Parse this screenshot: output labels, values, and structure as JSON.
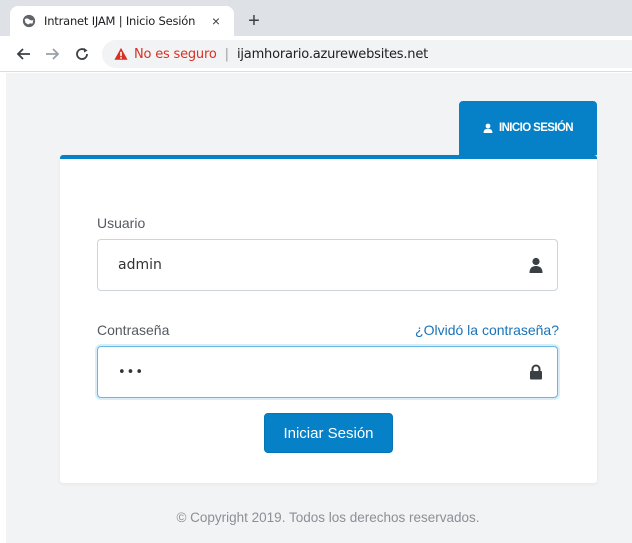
{
  "browser": {
    "tab_title": "Intranet IJAM | Inicio Sesión",
    "tab_close": "×",
    "new_tab": "+",
    "security_label": "No es seguro",
    "url": "ijamhorario.azurewebsites.net"
  },
  "login": {
    "tab_label": "INICIO SESIÓN",
    "username_label": "Usuario",
    "username_value": "admin",
    "password_label": "Contraseña",
    "forgot_password": "¿Olvidó la contraseña?",
    "password_value": "•••",
    "submit_label": "Iniciar Sesión"
  },
  "footer": {
    "copyright": "© Copyright 2019. Todos los derechos reservados."
  },
  "colors": {
    "accent": "#0680c6",
    "link": "#1a73b8",
    "insecure": "#d93025",
    "page_bg": "#f2f3f5"
  },
  "icons": {
    "favicon": "globe-icon",
    "back": "back-arrow-icon",
    "forward": "forward-arrow-icon",
    "reload": "reload-icon",
    "warning": "warning-icon",
    "user": "user-icon",
    "lock": "lock-icon"
  }
}
